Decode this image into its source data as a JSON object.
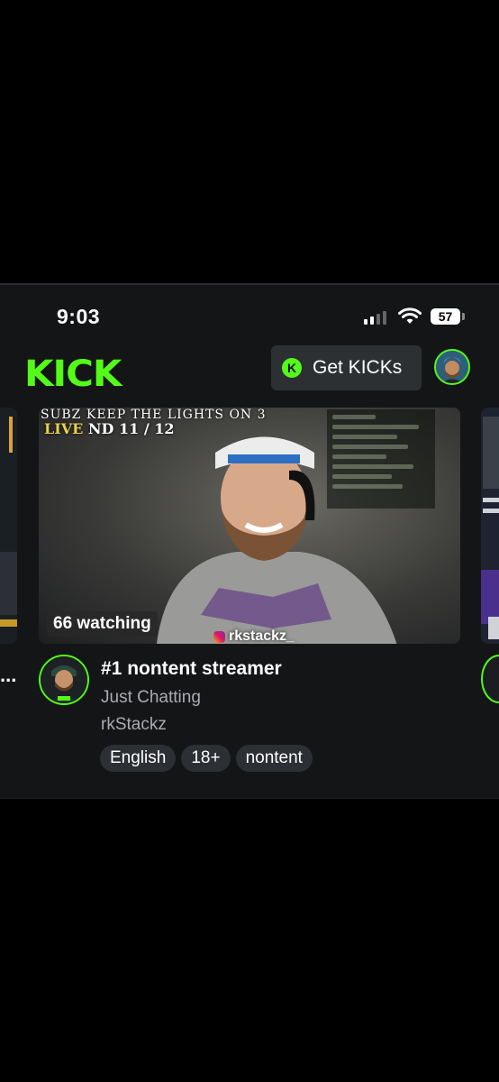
{
  "status_bar": {
    "time": "9:03",
    "battery": "57"
  },
  "header": {
    "logo": "KICK",
    "get_kicks_label": "Get KICKs",
    "kicks_icon_letter": "K"
  },
  "stream": {
    "overlay_banner": "SUBZ KEEP THE LIGHTS ON 3",
    "overlay_live_word": "LIVE",
    "overlay_count": "ND 11 / 12",
    "viewers_label": "66 watching",
    "social_handle": "rkstackz_",
    "title": "#1 nontent streamer",
    "category": "Just Chatting",
    "streamer": "rkStackz",
    "tags": [
      "English",
      "18+",
      "nontent"
    ]
  },
  "left_card": {
    "ellipsis": "..."
  },
  "colors": {
    "accent": "#53fc18",
    "background": "#141517",
    "tag_bg": "#2c2f33"
  }
}
